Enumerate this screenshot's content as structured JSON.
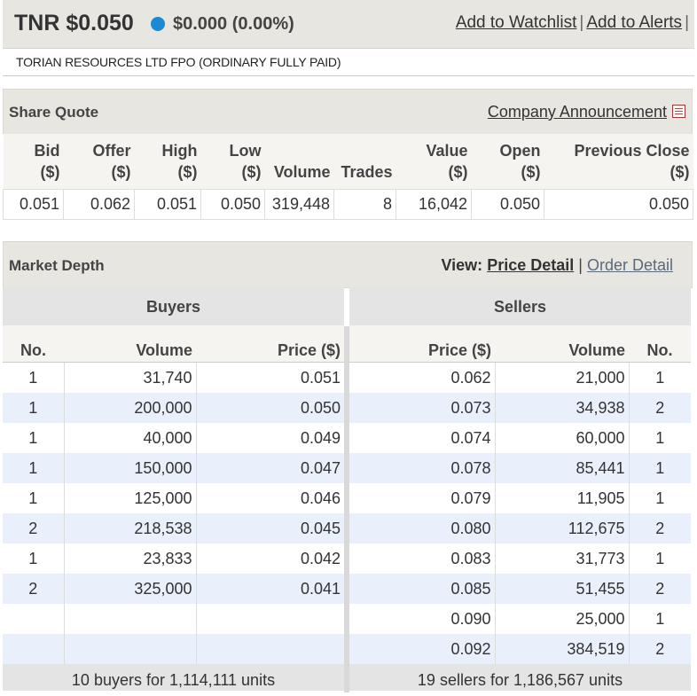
{
  "header": {
    "symbol_price": "TNR $0.050",
    "change": "$0.000 (0.00%)",
    "watchlist_link": "Add to Watchlist",
    "alerts_link": "Add to Alerts",
    "separator": "|",
    "company_name": "TORIAN RESOURCES LTD FPO (ORDINARY FULLY PAID)",
    "status_color": "#1a8ad4"
  },
  "share_quote": {
    "title": "Share Quote",
    "announcement_link": "Company Announcement",
    "headers": [
      {
        "l1": "Bid",
        "l2": "($)"
      },
      {
        "l1": "Offer",
        "l2": "($)"
      },
      {
        "l1": "High",
        "l2": "($)"
      },
      {
        "l1": "Low",
        "l2": "($)"
      },
      {
        "l1": "",
        "l2": "Volume"
      },
      {
        "l1": "",
        "l2": "Trades"
      },
      {
        "l1": "Value",
        "l2": "($)"
      },
      {
        "l1": "Open",
        "l2": "($)"
      },
      {
        "l1": "Previous Close",
        "l2": "($)"
      }
    ],
    "values": [
      "0.051",
      "0.062",
      "0.051",
      "0.050",
      "319,448",
      "8",
      "16,042",
      "0.050",
      "0.050"
    ]
  },
  "market_depth": {
    "title": "Market Depth",
    "view_label": "View:",
    "price_detail": "Price Detail",
    "order_detail": "Order Detail",
    "separator": "|",
    "buyers": {
      "title": "Buyers",
      "headers": [
        "No.",
        "Volume",
        "Price ($)"
      ],
      "rows": [
        [
          "1",
          "31,740",
          "0.051"
        ],
        [
          "1",
          "200,000",
          "0.050"
        ],
        [
          "1",
          "40,000",
          "0.049"
        ],
        [
          "1",
          "150,000",
          "0.047"
        ],
        [
          "1",
          "125,000",
          "0.046"
        ],
        [
          "2",
          "218,538",
          "0.045"
        ],
        [
          "1",
          "23,833",
          "0.042"
        ],
        [
          "2",
          "325,000",
          "0.041"
        ],
        [
          "",
          "",
          ""
        ],
        [
          "",
          "",
          ""
        ]
      ],
      "summary": "10 buyers for 1,114,111 units"
    },
    "sellers": {
      "title": "Sellers",
      "headers": [
        "Price ($)",
        "Volume",
        "No."
      ],
      "rows": [
        [
          "0.062",
          "21,000",
          "1"
        ],
        [
          "0.073",
          "34,938",
          "2"
        ],
        [
          "0.074",
          "60,000",
          "1"
        ],
        [
          "0.078",
          "85,441",
          "1"
        ],
        [
          "0.079",
          "11,905",
          "1"
        ],
        [
          "0.080",
          "112,675",
          "2"
        ],
        [
          "0.083",
          "31,773",
          "1"
        ],
        [
          "0.085",
          "51,455",
          "2"
        ],
        [
          "0.090",
          "25,000",
          "1"
        ],
        [
          "0.092",
          "384,519",
          "2"
        ]
      ],
      "summary": "19 sellers for 1,186,567 units"
    }
  }
}
